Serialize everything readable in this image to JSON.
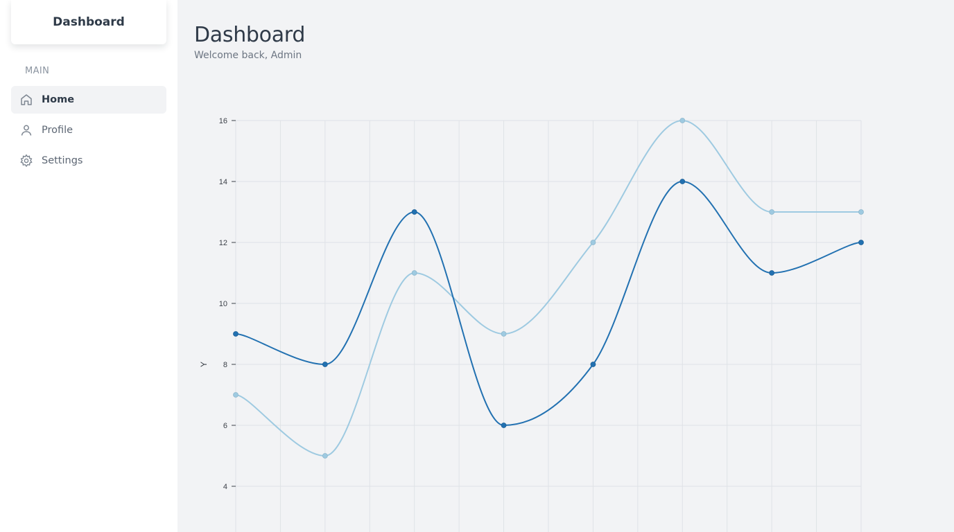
{
  "sidebar": {
    "brand": "Dashboard",
    "section_label": "MAIN",
    "items": [
      {
        "label": "Home",
        "icon": "home-icon",
        "active": true
      },
      {
        "label": "Profile",
        "icon": "user-icon",
        "active": false
      },
      {
        "label": "Settings",
        "icon": "gear-icon",
        "active": false
      }
    ]
  },
  "header": {
    "title": "Dashboard",
    "subtitle": "Welcome back, Admin"
  },
  "colors": {
    "series_dark": "#2271b1",
    "series_light": "#9ecae1",
    "grid": "#dfe2e6",
    "background": "#f2f3f5"
  },
  "chart_data": {
    "type": "line",
    "ylabel": "Y",
    "xlabel": "",
    "ylim": [
      3,
      16.5
    ],
    "yticks": [
      4,
      6,
      8,
      10,
      12,
      14,
      16
    ],
    "x": [
      0,
      1,
      2,
      3,
      4,
      5,
      6,
      7
    ],
    "grid": true,
    "curve": "smooth",
    "series": [
      {
        "color": "#2271b1",
        "values": [
          9,
          8,
          13,
          6,
          8,
          14,
          11,
          12
        ]
      },
      {
        "color": "#9ecae1",
        "values": [
          7,
          5,
          11,
          9,
          12,
          16,
          13,
          13
        ]
      }
    ]
  }
}
